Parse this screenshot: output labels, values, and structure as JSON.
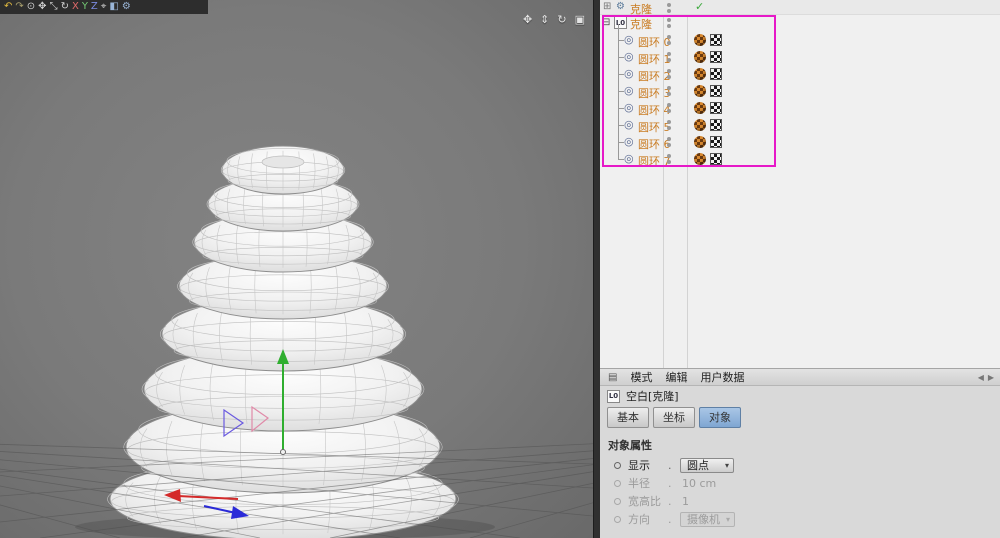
{
  "icons": {
    "grid": "⊞",
    "gear": "⚙",
    "check": "✓",
    "collapse": "⊟",
    "torus": "◎",
    "menu": "▤",
    "caret_down": "▾",
    "pan": "✥",
    "dolly": "⇕",
    "orbit": "↻",
    "maximize": "▣",
    "nav_left": "◀",
    "nav_right": "▶"
  },
  "toolbar": {
    "icons": [
      {
        "name": "undo-icon",
        "glyph": "↶",
        "color": "#e0b93f"
      },
      {
        "name": "redo-icon",
        "glyph": "↷",
        "color": "#a89f6e"
      },
      {
        "name": "select-icon",
        "glyph": "⊙",
        "color": "#d0d0d0"
      },
      {
        "name": "move-icon",
        "glyph": "✥",
        "color": "#d0d0d0"
      },
      {
        "name": "scale-icon",
        "glyph": "⤡",
        "color": "#d0d0d0"
      },
      {
        "name": "rotate-icon",
        "glyph": "↻",
        "color": "#d0d0d0"
      },
      {
        "name": "x-axis-icon",
        "glyph": "X",
        "color": "#e06a6a"
      },
      {
        "name": "y-axis-icon",
        "glyph": "Y",
        "color": "#74c974"
      },
      {
        "name": "z-axis-icon",
        "glyph": "Z",
        "color": "#7a8ae0"
      },
      {
        "name": "coordinates-icon",
        "glyph": "⌖",
        "color": "#d0d0d0"
      },
      {
        "name": "render-view-icon",
        "glyph": "◧",
        "color": "#9ab6d8"
      },
      {
        "name": "render-settings-icon",
        "glyph": "⚙",
        "color": "#9ab6d8"
      }
    ]
  },
  "viewport": {
    "controls": [
      {
        "name": "pan-view-icon",
        "glyph_key": "pan"
      },
      {
        "name": "dolly-view-icon",
        "glyph_key": "dolly"
      },
      {
        "name": "orbit-view-icon",
        "glyph_key": "orbit"
      },
      {
        "name": "maximize-view-icon",
        "glyph_key": "maximize"
      }
    ]
  },
  "object_manager": {
    "cloner": {
      "name": "克隆"
    },
    "null_object": {
      "name": "克隆",
      "icon_label": "L0"
    },
    "children": [
      {
        "name": "圆环 0"
      },
      {
        "name": "圆环 1"
      },
      {
        "name": "圆环 2"
      },
      {
        "name": "圆环 3"
      },
      {
        "name": "圆环 4"
      },
      {
        "name": "圆环 5"
      },
      {
        "name": "圆环 6"
      },
      {
        "name": "圆环 7"
      }
    ]
  },
  "attribute_manager": {
    "menu_items": [
      "模式",
      "编辑",
      "用户数据"
    ],
    "object_label": "空白[克隆]",
    "object_icon_label": "L0",
    "tabs": [
      {
        "label": "基本",
        "active": false
      },
      {
        "label": "坐标",
        "active": false
      },
      {
        "label": "对象",
        "active": true
      }
    ],
    "section_title": "对象属性",
    "properties": [
      {
        "label": "显示",
        "value": "圆点",
        "control": "dropdown",
        "enabled": true
      },
      {
        "label": "半径",
        "value": "10 cm",
        "control": "field",
        "enabled": false
      },
      {
        "label": "宽高比",
        "value": "1",
        "control": "field",
        "enabled": false
      },
      {
        "label": "方向",
        "value": "摄像机",
        "control": "dropdown",
        "enabled": false
      }
    ]
  },
  "colors": {
    "annotation": "#e619c8",
    "object_name": "#c97b21",
    "check_green": "#3aa83a",
    "tab_active": "#7fa6d2"
  }
}
